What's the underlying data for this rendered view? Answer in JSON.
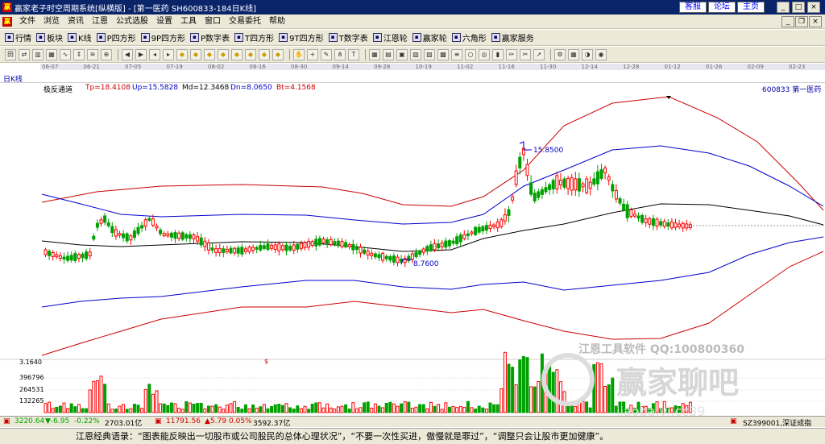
{
  "window": {
    "title": "赢家老子时空周期系统[纵横版] - [第一医药  SH600833-184日K线]",
    "links": [
      "客服",
      "论坛",
      "主页"
    ]
  },
  "menu": [
    "文件",
    "浏览",
    "资讯",
    "江恩",
    "公式选股",
    "设置",
    "工具",
    "窗口",
    "交易委托",
    "帮助"
  ],
  "toolbar1": [
    {
      "label": "行情",
      "icon": "grid-icon"
    },
    {
      "label": "板块",
      "icon": "block-icon"
    },
    {
      "label": "K线",
      "icon": "candle-icon"
    },
    {
      "label": "P四方形",
      "icon": "p-square-icon"
    },
    {
      "label": "9P四方形",
      "icon": "9p-square-icon"
    },
    {
      "label": "P数字表",
      "icon": "p-table-icon"
    },
    {
      "label": "T四方形",
      "icon": "t-square-icon"
    },
    {
      "label": "9T四方形",
      "icon": "9t-square-icon"
    },
    {
      "label": "T数字表",
      "icon": "t-table-icon"
    },
    {
      "label": "江恩轮",
      "icon": "gann-wheel-icon"
    },
    {
      "label": "赢家轮",
      "icon": "winner-wheel-icon"
    },
    {
      "label": "六角形",
      "icon": "hexagon-icon"
    },
    {
      "label": "赢家服务",
      "icon": "service-icon"
    }
  ],
  "toolbar2_icons": [
    "chart-type-icon",
    "sync-icon",
    "bar-icon",
    "chart-icon",
    "line-icon",
    "updown-icon",
    "indicator-icon",
    "zoom-icon",
    "prev-icon",
    "next-icon",
    "left-icon",
    "right-icon",
    "diamond-icon",
    "diamond2-icon",
    "diamond3-icon",
    "diamond4-icon",
    "diamond5-icon",
    "diamond6-icon",
    "diamond7-icon",
    "diamond8-icon",
    "hand-icon",
    "cross-icon",
    "draw-icon",
    "fork-icon",
    "text-icon",
    "grid2-icon",
    "layout-icon",
    "window-icon",
    "save-icon",
    "print-icon",
    "car-icon",
    "bars-icon",
    "cycle-icon",
    "cycle2-icon",
    "vol-icon",
    "pen-icon",
    "cut-icon",
    "arrow2-icon",
    "settings-icon",
    "table-icon",
    "color-icon",
    "pin-icon"
  ],
  "dates": [
    "06-07",
    "06-21",
    "07-05",
    "07-19",
    "08-02",
    "08-16",
    "08-30",
    "09-14",
    "09-28",
    "10-19",
    "11-02",
    "11-16",
    "11-30",
    "12-14",
    "12-28",
    "01-12",
    "01-26",
    "02-09",
    "02-23"
  ],
  "chart_mode": "日K线",
  "indicator": {
    "name": "极反通道",
    "tp": "Tp=18.4108",
    "up": "Up=15.5828",
    "md": "Md=12.3468",
    "dn": "Dn=8.0650",
    "bt": "Bt=4.1568"
  },
  "stock_label": "600833  第一医药",
  "annotations": {
    "high": "15.8500",
    "low": "8.7600",
    "left_value": "3.1640",
    "dollar": "$"
  },
  "volume_axis": [
    "396796",
    "264531",
    "132265"
  ],
  "watermark1": "江恩工具软件  QQ:100800360",
  "watermark2": "赢家聊吧",
  "watermark3": "jiaoba.vi.cc39",
  "status": {
    "sh": "3220.64",
    "sh_change": "▼-6.95",
    "sh_pct": "-0.22%",
    "sh_amount": "2703.01亿",
    "sz": "11791.56",
    "sz_change": "▲5.79",
    "sz_pct": "0.05%",
    "sz_amount": "3592.37亿",
    "right": "SZ399001,深证成指"
  },
  "quote": "江恩经典语录：“图表能反映出一切股市或公司股民的总体心理状况”，“不要一次性买进，傲慢就是罪过”，“调整只会让股市更加健康”。",
  "colors": {
    "up": "#ff0000",
    "down": "#00a000",
    "mid": "#000000",
    "inner": "#0000cc",
    "outer": "#cc0000"
  }
}
